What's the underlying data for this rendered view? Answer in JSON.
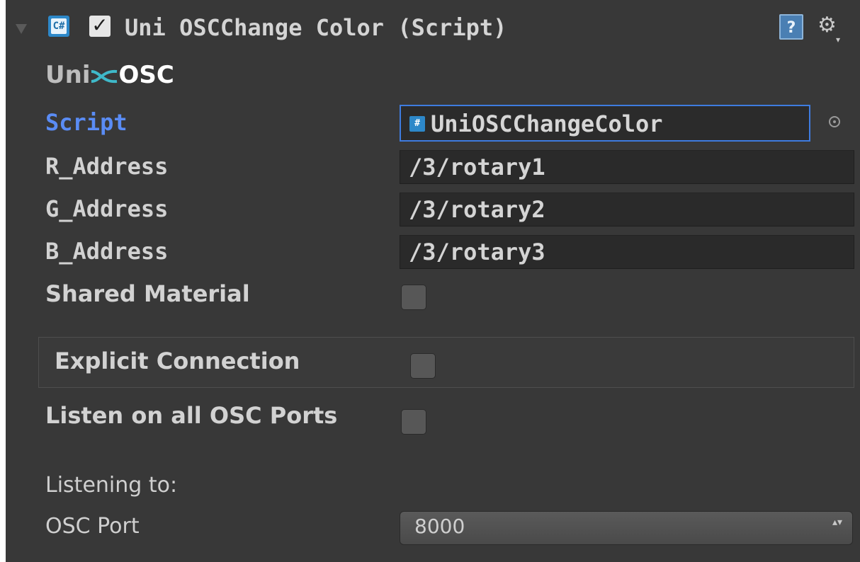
{
  "component": {
    "title": "Uni OSCChange Color (Script)",
    "enabled_checkmark": "✓",
    "cs_icon_text": "C#",
    "help_icon": "?",
    "gear_icon": "⚙",
    "gear_caret": "▾",
    "logo": {
      "left": "Uni",
      "right": "OSC"
    }
  },
  "fields": {
    "script": {
      "label": "Script",
      "value": "UniOSCChangeColor"
    },
    "r_address": {
      "label": "R_Address",
      "value": "/3/rotary1"
    },
    "g_address": {
      "label": "G_Address",
      "value": "/3/rotary2"
    },
    "b_address": {
      "label": "B_Address",
      "value": "/3/rotary3"
    },
    "shared_material": {
      "label": "Shared Material",
      "checked": false
    },
    "explicit_connection": {
      "label": "Explicit Connection",
      "checked": false
    },
    "listen_all_ports": {
      "label": "Listen on all OSC Ports",
      "checked": false
    },
    "listening_to": {
      "label": "Listening to:"
    },
    "osc_port": {
      "label": "OSC Port",
      "value": "8000",
      "arrows": "▴▾"
    }
  },
  "colors": {
    "panel_bg": "#383838",
    "script_label": "#5a8cf5",
    "focus_border": "#3e7ce0",
    "logo_accent": "#3fb9c9"
  }
}
